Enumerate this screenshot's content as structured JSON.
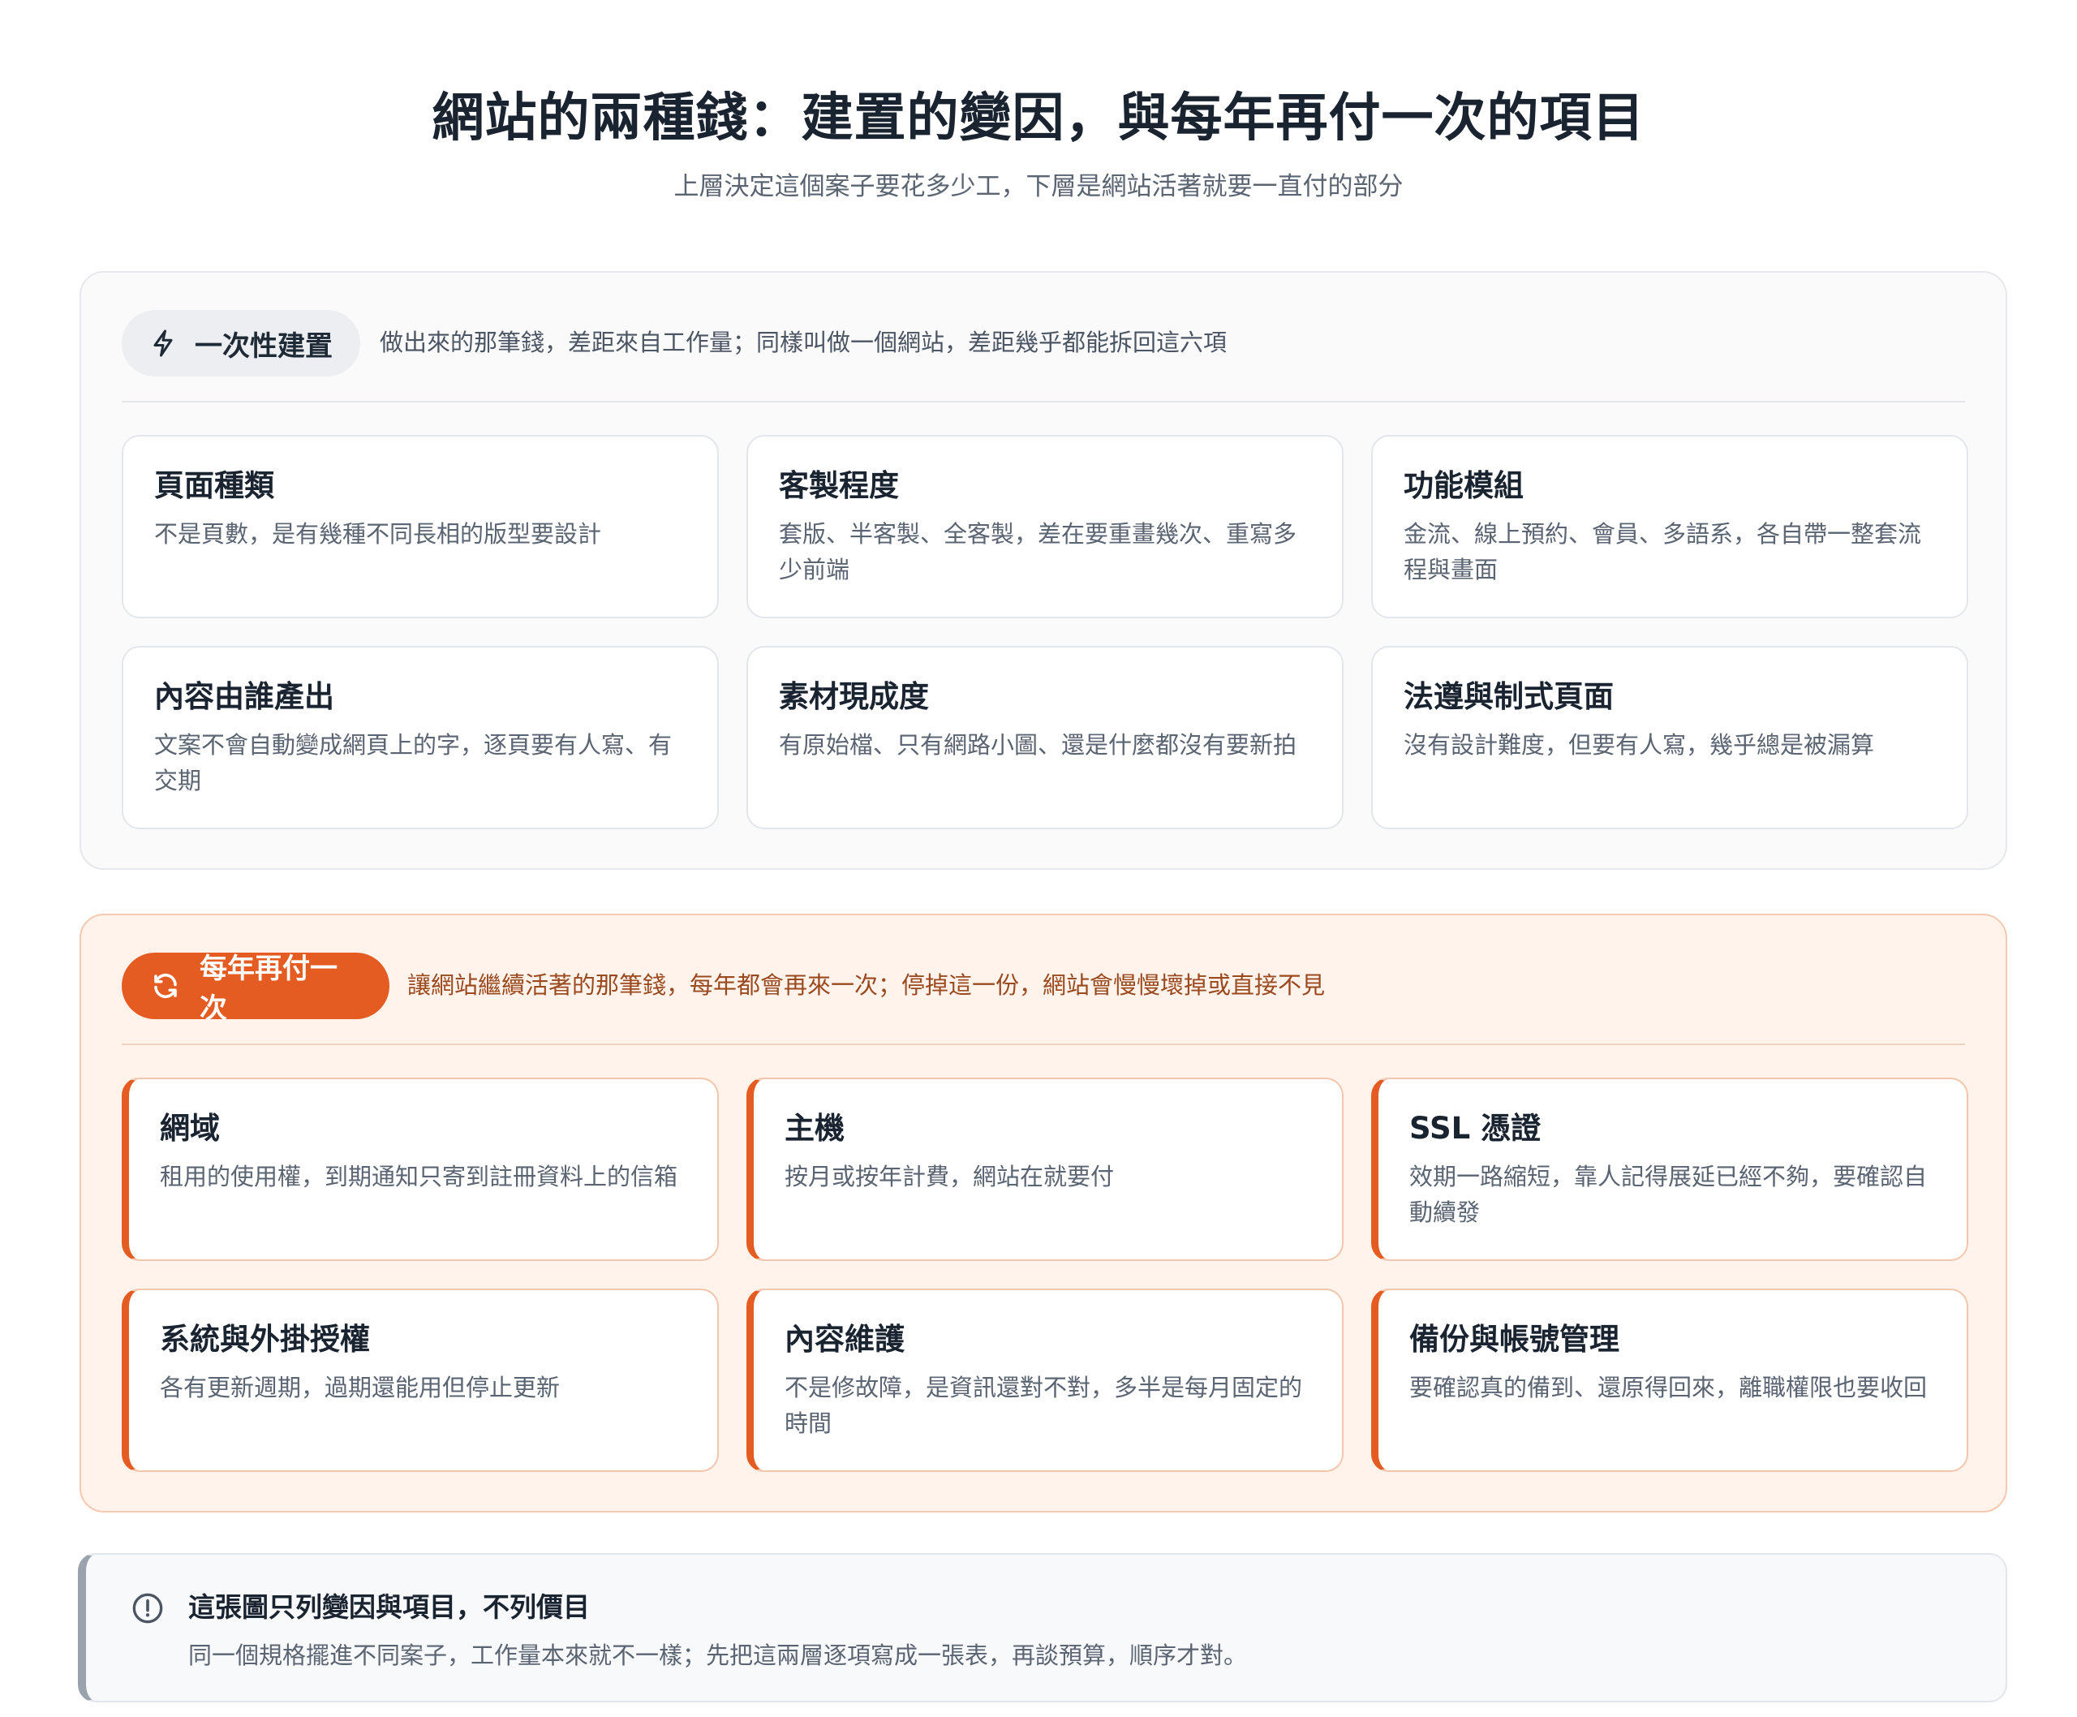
{
  "header": {
    "title": "網站的兩種錢：建置的變因，與每年再付一次的項目",
    "subtitle": "上層決定這個案子要花多少工，下層是網站活著就要一直付的部分"
  },
  "build": {
    "label": "一次性建置",
    "icon": "lightning-icon",
    "description": "做出來的那筆錢，差距來自工作量；同樣叫做一個網站，差距幾乎都能拆回這六項",
    "items": [
      {
        "title": "頁面種類",
        "desc": "不是頁數，是有幾種不同長相的版型要設計"
      },
      {
        "title": "客製程度",
        "desc": "套版、半客製、全客製，差在要重畫幾次、重寫多少前端"
      },
      {
        "title": "功能模組",
        "desc": "金流、線上預約、會員、多語系，各自帶一整套流程與畫面"
      },
      {
        "title": "內容由誰產出",
        "desc": "文案不會自動變成網頁上的字，逐頁要有人寫、有交期"
      },
      {
        "title": "素材現成度",
        "desc": "有原始檔、只有網路小圖、還是什麼都沒有要新拍"
      },
      {
        "title": "法遵與制式頁面",
        "desc": "沒有設計難度，但要有人寫，幾乎總是被漏算"
      }
    ]
  },
  "yearly": {
    "label": "每年再付一次",
    "icon": "refresh-icon",
    "description": "讓網站繼續活著的那筆錢，每年都會再來一次；停掉這一份，網站會慢慢壞掉或直接不見",
    "items": [
      {
        "title": "網域",
        "desc": "租用的使用權，到期通知只寄到註冊資料上的信箱"
      },
      {
        "title": "主機",
        "desc": "按月或按年計費，網站在就要付"
      },
      {
        "title": "SSL 憑證",
        "desc": "效期一路縮短，靠人記得展延已經不夠，要確認自動續發"
      },
      {
        "title": "系統與外掛授權",
        "desc": "各有更新週期，過期還能用但停止更新"
      },
      {
        "title": "內容維護",
        "desc": "不是修故障，是資訊還對不對，多半是每月固定的時間"
      },
      {
        "title": "備份與帳號管理",
        "desc": "要確認真的備到、還原得回來，離職權限也要收回"
      }
    ]
  },
  "note": {
    "icon": "alert-circle-icon",
    "title": "這張圖只列變因與項目，不列價目",
    "text": "同一個規格擺進不同案子，工作量本來就不一樣；先把這兩層逐項寫成一張表，再談預算，順序才對。"
  },
  "colors": {
    "accent": "#e45c22",
    "build_panel_bg": "#fafafa",
    "yearly_panel_bg": "#fff3ec",
    "title_text": "#1a2330",
    "body_text": "#5b6472"
  }
}
